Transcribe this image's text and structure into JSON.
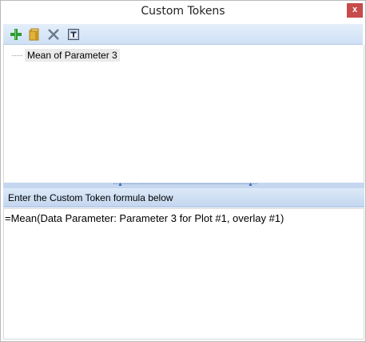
{
  "window": {
    "title": "Custom Tokens",
    "close_label": "x"
  },
  "toolbar": {
    "buttons": [
      {
        "name": "add-token-button",
        "icon": "plus-icon",
        "tooltip": ""
      },
      {
        "name": "open-token-button",
        "icon": "folder-icon",
        "tooltip": ""
      },
      {
        "name": "delete-token-button",
        "icon": "delete-x-icon",
        "tooltip": ""
      },
      {
        "name": "rename-token-button",
        "icon": "text-t-icon",
        "tooltip": ""
      }
    ]
  },
  "tree": {
    "items": [
      {
        "label": "Mean of Parameter 3"
      }
    ]
  },
  "formula": {
    "header": "Enter the Custom Token formula below",
    "value": "=Mean(Data Parameter: Parameter 3 for Plot #1, overlay #1)"
  },
  "colors": {
    "accent": "#c5d7ee",
    "close": "#c74b4b",
    "plus": "#2e9a2e"
  }
}
